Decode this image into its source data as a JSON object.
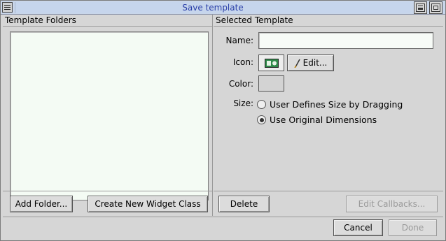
{
  "window": {
    "title": "Save template"
  },
  "left_panel": {
    "header": "Template Folders",
    "add_folder_label": "Add Folder...",
    "create_class_label": "Create New Widget Class"
  },
  "right_panel": {
    "header": "Selected Template",
    "name_label": "Name:",
    "name_value": "",
    "icon_label": "Icon:",
    "edit_icon_label": "Edit...",
    "color_label": "Color:",
    "size_label": "Size:",
    "size_options": [
      {
        "label": "User Defines Size by Dragging",
        "selected": false
      },
      {
        "label": "Use Original Dimensions",
        "selected": true
      }
    ],
    "delete_label": "Delete",
    "edit_callbacks_label": "Edit Callbacks..."
  },
  "dialog_buttons": {
    "cancel_label": "Cancel",
    "done_label": "Done"
  },
  "colors": {
    "titlebar": "#c9d6ea",
    "title_text": "#2a3fa8",
    "list_bg": "#f4fbf4",
    "window_bg": "#d6d6d6"
  }
}
